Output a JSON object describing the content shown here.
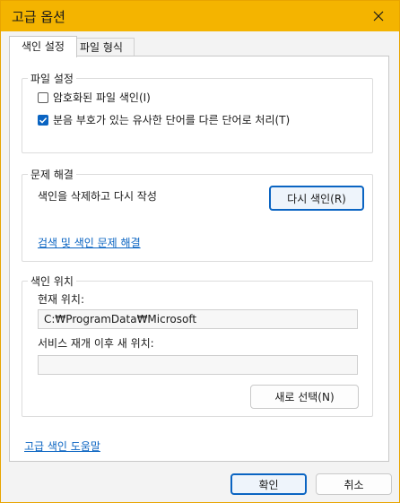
{
  "window": {
    "title": "고급 옵션"
  },
  "tabs": [
    {
      "label": "색인 설정"
    },
    {
      "label": "파일 형식"
    }
  ],
  "file_settings": {
    "legend": "파일 설정",
    "encrypted_label": "암호화된 파일 색인(I)",
    "encrypted_checked": false,
    "diacritics_label": "분음 부호가 있는 유사한 단어를 다른 단어로 처리(T)",
    "diacritics_checked": true
  },
  "troubleshooting": {
    "legend": "문제 해결",
    "rebuild_text": "색인을 삭제하고 다시 작성",
    "rebuild_button": "다시 색인(R)",
    "troubleshoot_link": "검색 및 색인 문제 해결"
  },
  "index_location": {
    "legend": "색인 위치",
    "current_label": "현재 위치:",
    "current_value": "C:₩ProgramData₩Microsoft",
    "new_label": "서비스 재개 이후 새 위치:",
    "new_value": "",
    "select_new_button": "새로 선택(N)"
  },
  "help_link": "고급 색인 도움말",
  "footer": {
    "ok_button": "확인",
    "cancel_button": "취소"
  }
}
